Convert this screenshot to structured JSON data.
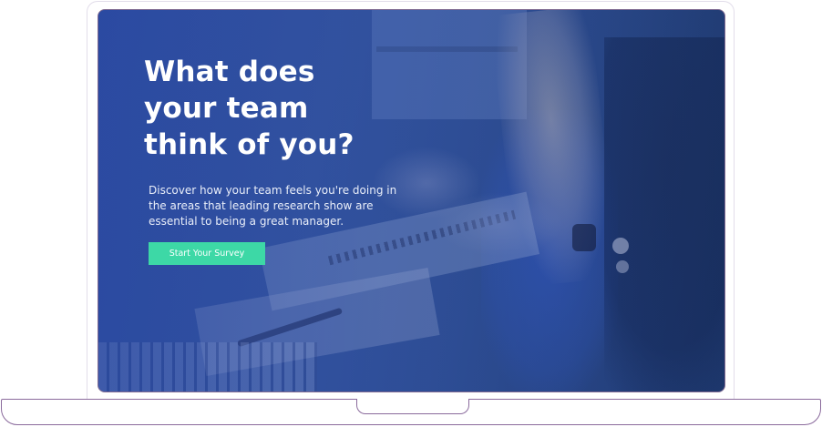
{
  "hero": {
    "title_lines": [
      "What does",
      "your team",
      "think of you?"
    ],
    "subtitle": "Discover how your team feels you're doing in the areas that leading research show are essential to being a great manager.",
    "cta_label": "Start Your Survey"
  },
  "colors": {
    "overlay": "#2f4fa3",
    "cta": "#3dd8a6",
    "text": "#ffffff",
    "laptop_outline": "#8a6a9c"
  }
}
